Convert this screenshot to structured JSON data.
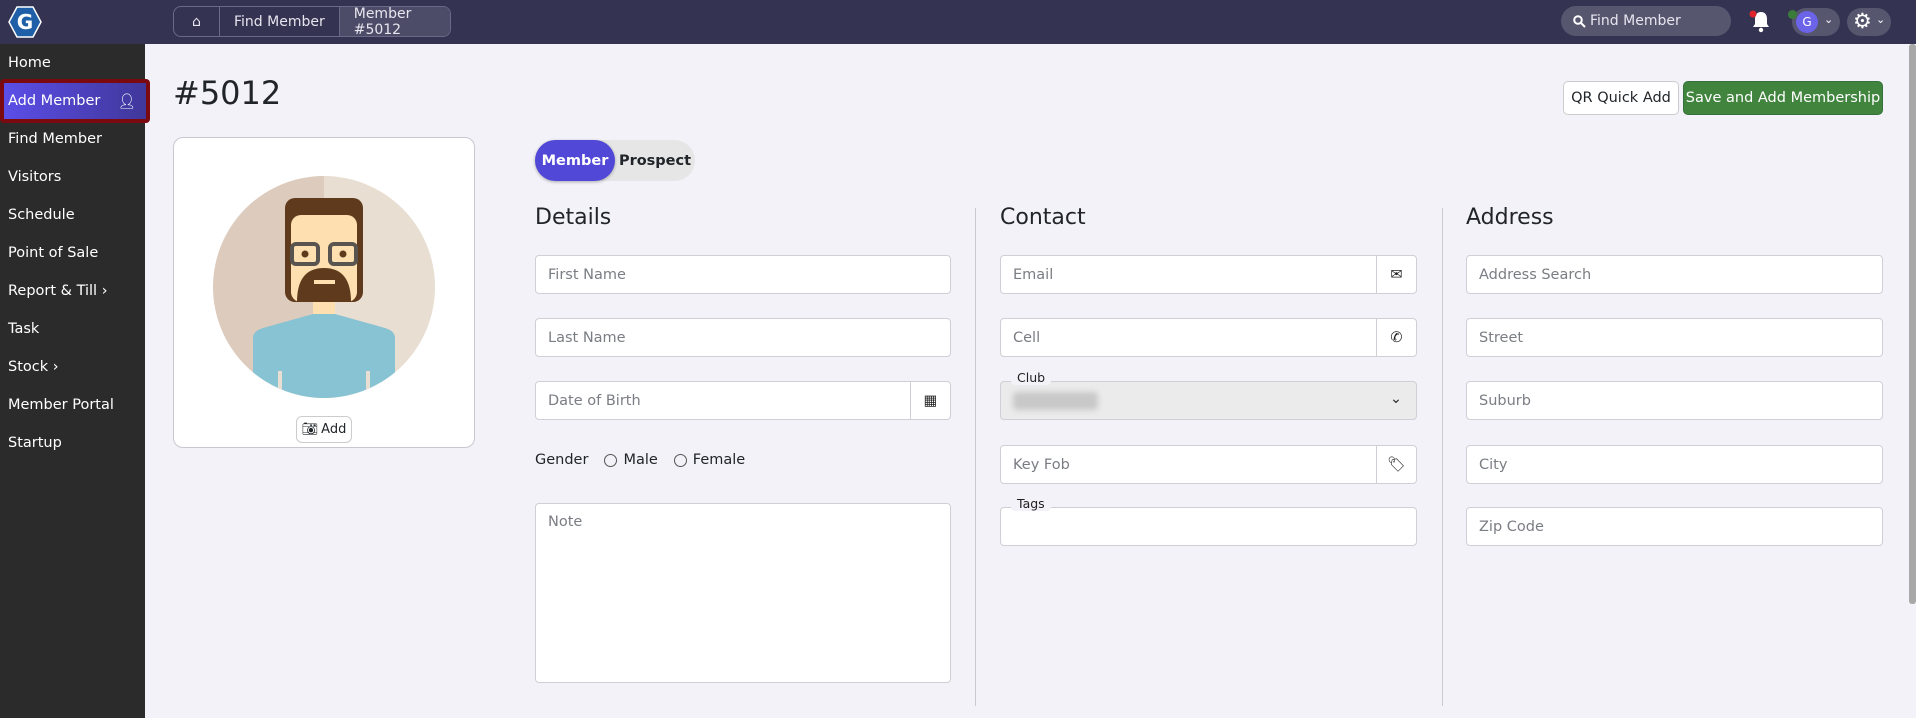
{
  "topbar": {
    "breadcrumb": [
      "Find Member",
      "Member #5012"
    ],
    "search_placeholder": "Find Member",
    "user_initial": "G"
  },
  "sidebar": {
    "items": [
      "Home",
      "Add Member",
      "Find Member",
      "Visitors",
      "Schedule",
      "Point of Sale",
      "Report & Till ›",
      "Task",
      "Stock ›",
      "Member Portal",
      "Startup"
    ]
  },
  "page": {
    "title": "#5012",
    "qr_label": "QR Quick Add",
    "save_label": "Save and Add Membership",
    "photo_add": "Add",
    "toggle": {
      "active": "Member",
      "inactive": "Prospect"
    }
  },
  "details": {
    "heading": "Details",
    "first_name": "First Name",
    "last_name": "Last Name",
    "dob": "Date of Birth",
    "gender_label": "Gender",
    "male": "Male",
    "female": "Female",
    "note": "Note"
  },
  "contact": {
    "heading": "Contact",
    "email": "Email",
    "cell": "Cell",
    "club_label": "Club",
    "key_fob": "Key Fob",
    "tags_label": "Tags"
  },
  "address": {
    "heading": "Address",
    "search": "Address Search",
    "street": "Street",
    "suburb": "Suburb",
    "city": "City",
    "zip": "Zip Code"
  },
  "colors": {
    "accent": "#5148d8",
    "save": "#41843e",
    "topbar": "#343351"
  }
}
